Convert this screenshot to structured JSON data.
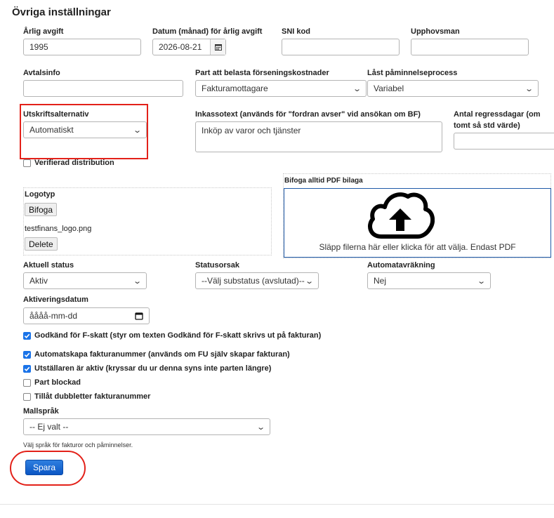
{
  "section": {
    "title": "Övriga inställningar"
  },
  "fields": {
    "arlig_avgift": {
      "label": "Årlig avgift",
      "value": "1995"
    },
    "datum": {
      "label": "Datum (månad) för årlig avgift",
      "value": "2026-08-21"
    },
    "sni": {
      "label": "SNI kod",
      "value": ""
    },
    "upphovsman": {
      "label": "Upphovsman",
      "value": ""
    },
    "avtalsinfo": {
      "label": "Avtalsinfo",
      "value": ""
    },
    "part_belasta": {
      "label": "Part att belasta förseningskostnader",
      "value": "Fakturamottagare"
    },
    "last_process": {
      "label": "Låst påminnelseprocess",
      "value": "Variabel"
    },
    "utskrift": {
      "label": "Utskriftsalternativ",
      "value": "Automatiskt"
    },
    "inkasso": {
      "label": "Inkassotext (används för \"fordran avser\" vid ansökan om BF)",
      "value": "Inköp av varor och tjänster"
    },
    "regress": {
      "label": "Antal regressdagar (om tomt så std värde)",
      "value": ""
    },
    "verifierad": {
      "label": "Verifierad distribution",
      "checked": false
    },
    "logotyp": {
      "label": "Logotyp",
      "attach_label": "Bifoga",
      "filename": "testfinans_logo.png",
      "delete_label": "Delete"
    },
    "pdf": {
      "label": "Bifoga alltid PDF bilaga",
      "drop_text": "Släpp filerna här eller klicka för att välja. Endast PDF"
    },
    "aktuell_status": {
      "label": "Aktuell status",
      "value": "Aktiv"
    },
    "statusorsak": {
      "label": "Statusorsak",
      "value": "--Välj substatus (avslutad)--"
    },
    "automataviakning": {
      "label": "Automatavräkning",
      "value": "Nej"
    },
    "aktiveringsdatum": {
      "label": "Aktiveringsdatum",
      "placeholder": "åååå-mm-dd"
    },
    "mallsprak": {
      "label": "Mallspråk",
      "value": "-- Ej valt --",
      "hint": "Välj språk för fakturor och påminnelser."
    }
  },
  "checkboxes": [
    {
      "label": "Godkänd för F-skatt (styr om texten Godkänd för F-skatt skrivs ut på fakturan)",
      "checked": true
    },
    {
      "label": "Automatskapa fakturanummer (används om FU själv skapar fakturan)",
      "checked": true
    },
    {
      "label": "Utställaren är aktiv (kryssar du ur denna syns inte parten längre)",
      "checked": true
    },
    {
      "label": "Part blockad",
      "checked": false
    },
    {
      "label": "Tillåt dubbletter fakturanummer",
      "checked": false
    }
  ],
  "actions": {
    "save_label": "Spara"
  },
  "colors": {
    "accent": "#1a73e8",
    "highlight": "#e32119",
    "save_button": "#0b56c4"
  },
  "icons": {
    "calendar": "calendar-icon",
    "upload": "cloud-upload-icon",
    "chevron": "chevron-down-icon"
  }
}
